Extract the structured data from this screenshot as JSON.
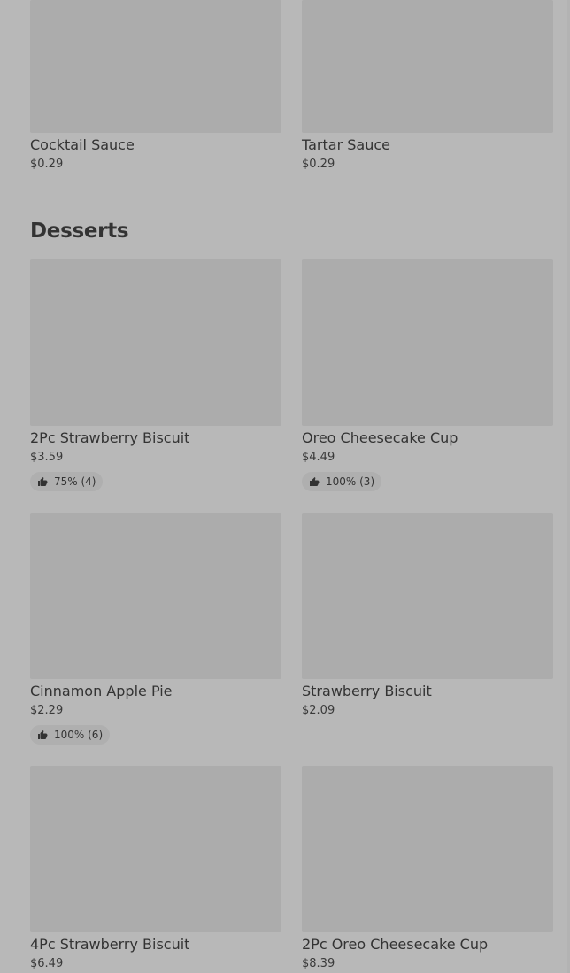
{
  "top_items": [
    {
      "name": "Cocktail Sauce",
      "price": "$0.29"
    },
    {
      "name": "Tartar Sauce",
      "price": "$0.29"
    }
  ],
  "desserts": {
    "title": "Desserts",
    "items": [
      {
        "name": "2Pc Strawberry Biscuit",
        "price": "$3.59",
        "rating": "75% (4)"
      },
      {
        "name": "Oreo Cheesecake Cup",
        "price": "$4.49",
        "rating": "100% (3)"
      },
      {
        "name": "Cinnamon Apple Pie",
        "price": "$2.29",
        "rating": "100% (6)"
      },
      {
        "name": "Strawberry Biscuit",
        "price": "$2.09"
      },
      {
        "name": "4Pc Strawberry Biscuit",
        "price": "$6.49"
      },
      {
        "name": "2Pc Oreo Cheesecake Cup",
        "price": "$8.39"
      }
    ]
  },
  "icons": {
    "rating_icon": "thumbs-up-icon"
  }
}
